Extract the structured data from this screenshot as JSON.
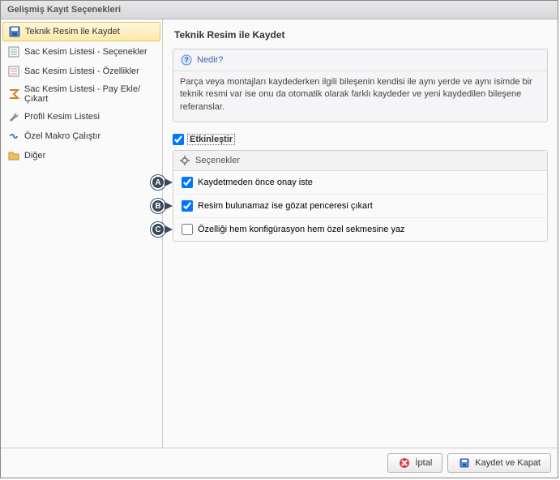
{
  "window": {
    "title": "Gelişmiş Kayıt Seçenekleri"
  },
  "sidebar": {
    "items": [
      {
        "label": "Teknik Resim ile Kaydet",
        "selected": true,
        "icon": "save-drawing-icon"
      },
      {
        "label": "Sac Kesim Listesi - Seçenekler",
        "selected": false,
        "icon": "list-options-icon"
      },
      {
        "label": "Sac Kesim Listesi - Özellikler",
        "selected": false,
        "icon": "list-properties-icon"
      },
      {
        "label": "Sac Kesim Listesi - Pay Ekle/Çıkart",
        "selected": false,
        "icon": "sigma-icon"
      },
      {
        "label": "Profil Kesim Listesi",
        "selected": false,
        "icon": "wrench-icon"
      },
      {
        "label": "Özel Makro Çalıştır",
        "selected": false,
        "icon": "infinity-icon"
      },
      {
        "label": "Diğer",
        "selected": false,
        "icon": "folder-icon"
      }
    ]
  },
  "main": {
    "heading": "Teknik Resim ile Kaydet",
    "help": {
      "title": "Nedir?",
      "body": "Parça veya montajları kaydederken ilgili bileşenin kendisi ile aynı yerde ve aynı isimde bir teknik resmi var ise onu da otomatik olarak farklı kaydeder ve yeni kaydedilen bileşene referanslar."
    },
    "enable": {
      "label": "Etkinleştir",
      "checked": true
    },
    "optionsTitle": "Seçenekler",
    "options": [
      {
        "callout": "A",
        "label": "Kaydetmeden önce onay iste",
        "checked": true
      },
      {
        "callout": "B",
        "label": "Resim bulunamaz ise gözat penceresi çıkart",
        "checked": true
      },
      {
        "callout": "C",
        "label": "Özelliği hem konfigürasyon hem özel sekmesine yaz",
        "checked": false
      }
    ]
  },
  "footer": {
    "cancel": "İptal",
    "save": "Kaydet ve Kapat"
  }
}
